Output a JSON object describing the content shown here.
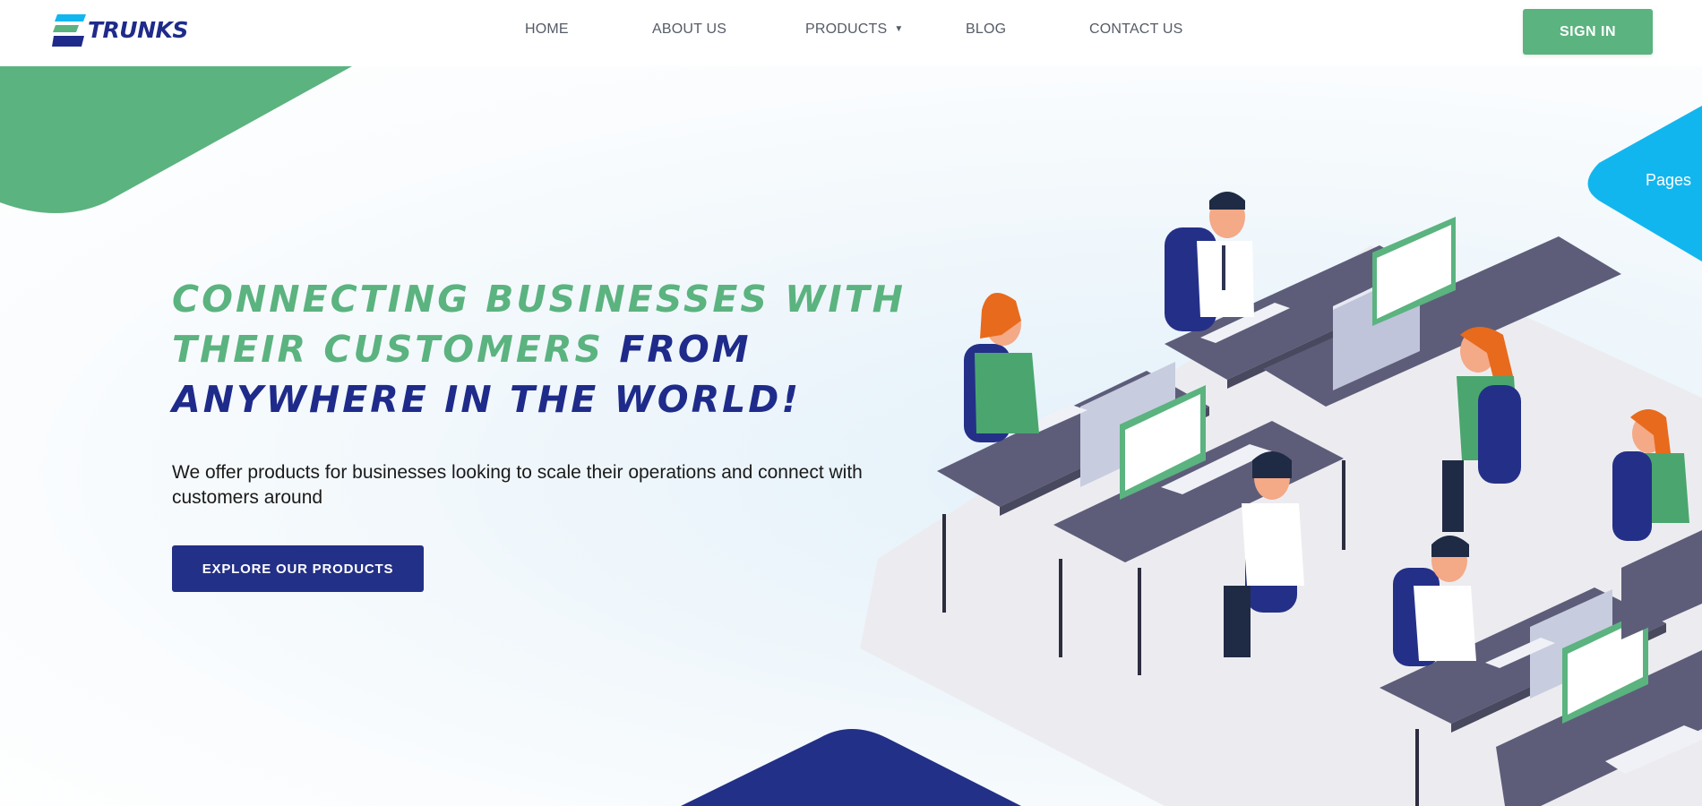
{
  "brand": {
    "logo_text": "TRUNKS"
  },
  "nav": {
    "home": "HOME",
    "about": "ABOUT US",
    "products": "PRODUCTS",
    "blog": "BLOG",
    "contact": "CONTACT US"
  },
  "header": {
    "signin_label": "SIGN IN"
  },
  "hero": {
    "headline_green": "CONNECTING BUSINESSES WITH THEIR CUSTOMERS",
    "headline_blue_inline": "FROM",
    "headline_blue_line": "ANYWHERE IN THE WORLD!",
    "tagline": "We offer products for businesses looking to scale their operations and connect with customers around",
    "cta_label": "EXPLORE OUR PRODUCTS"
  },
  "side_tab": {
    "label": "Pages"
  },
  "icons": {
    "products_dropdown": "chevron-down-icon"
  },
  "colors": {
    "brand_blue": "#1f2b8a",
    "brand_green": "#5bb37f",
    "accent_cyan": "#12b6ef",
    "cta_blue": "#233087"
  }
}
